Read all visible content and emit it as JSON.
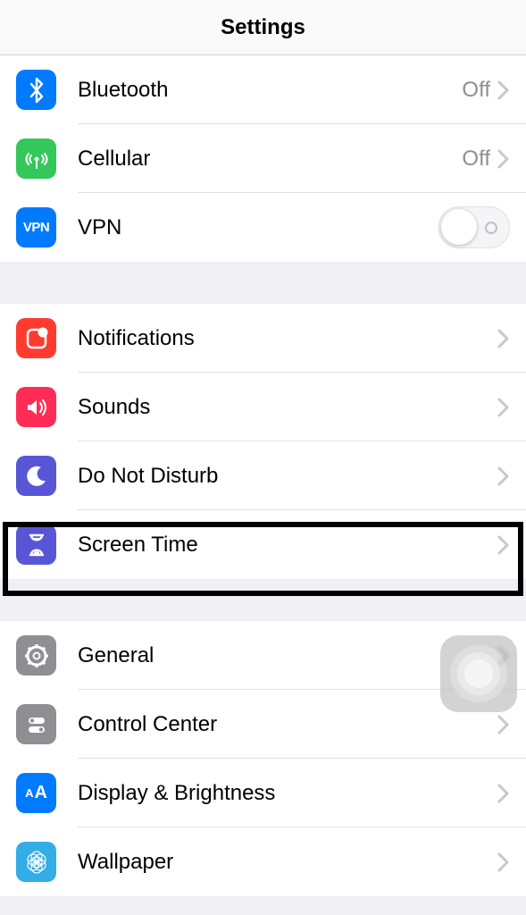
{
  "header": {
    "title": "Settings"
  },
  "rows": {
    "bluetooth": {
      "label": "Bluetooth",
      "value": "Off"
    },
    "cellular": {
      "label": "Cellular",
      "value": "Off"
    },
    "vpn": {
      "label": "VPN",
      "vpn_text": "VPN",
      "toggle": false
    },
    "notifications": {
      "label": "Notifications"
    },
    "sounds": {
      "label": "Sounds"
    },
    "dnd": {
      "label": "Do Not Disturb"
    },
    "screentime": {
      "label": "Screen Time"
    },
    "general": {
      "label": "General"
    },
    "controlcenter": {
      "label": "Control Center"
    },
    "display": {
      "label": "Display & Brightness",
      "aa_text": "AA"
    },
    "wallpaper": {
      "label": "Wallpaper"
    }
  },
  "highlight": {
    "target": "screentime"
  }
}
